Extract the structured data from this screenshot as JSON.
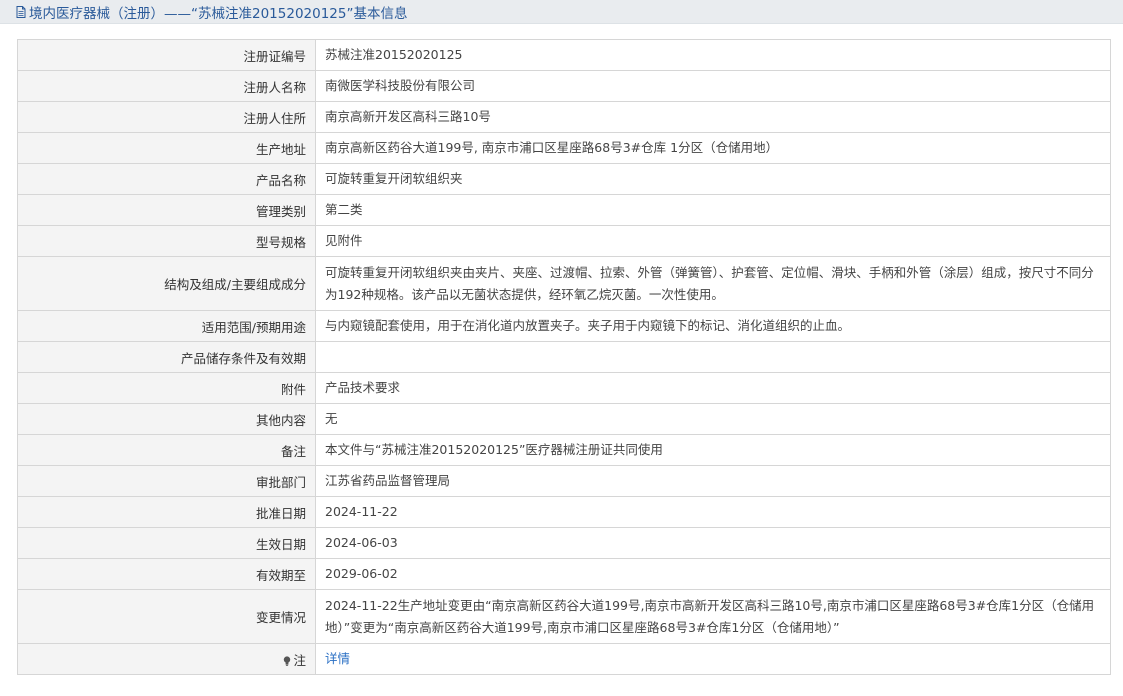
{
  "header": {
    "title": "境内医疗器械（注册）——“苏械注准20152020125”基本信息"
  },
  "rows": [
    {
      "label": "注册证编号",
      "value": "苏械注准20152020125"
    },
    {
      "label": "注册人名称",
      "value": "南微医学科技股份有限公司"
    },
    {
      "label": "注册人住所",
      "value": "南京高新开发区高科三路10号"
    },
    {
      "label": "生产地址",
      "value": "南京高新区药谷大道199号, 南京市浦口区星座路68号3#仓库 1分区（仓储用地）"
    },
    {
      "label": "产品名称",
      "value": "可旋转重复开闭软组织夹"
    },
    {
      "label": "管理类别",
      "value": "第二类"
    },
    {
      "label": "型号规格",
      "value": "见附件"
    },
    {
      "label": "结构及组成/主要组成成分",
      "value": "可旋转重复开闭软组织夹由夹片、夹座、过渡帽、拉索、外管（弹簧管）、护套管、定位帽、滑块、手柄和外管（涂层）组成，按尺寸不同分为192种规格。该产品以无菌状态提供，经环氧乙烷灭菌。一次性使用。"
    },
    {
      "label": "适用范围/预期用途",
      "value": "与内窥镜配套使用，用于在消化道内放置夹子。夹子用于内窥镜下的标记、消化道组织的止血。"
    },
    {
      "label": "产品储存条件及有效期",
      "value": ""
    },
    {
      "label": "附件",
      "value": "产品技术要求"
    },
    {
      "label": "其他内容",
      "value": "无"
    },
    {
      "label": "备注",
      "value": "本文件与“苏械注准20152020125”医疗器械注册证共同使用"
    },
    {
      "label": "审批部门",
      "value": "江苏省药品监督管理局"
    },
    {
      "label": "批准日期",
      "value": "2024-11-22"
    },
    {
      "label": "生效日期",
      "value": "2024-06-03"
    },
    {
      "label": "有效期至",
      "value": "2029-06-02"
    },
    {
      "label": "变更情况",
      "value": "2024-11-22生产地址变更由“南京高新区药谷大道199号,南京市高新开发区高科三路10号,南京市浦口区星座路68号3#仓库1分区（仓储用地）”变更为“南京高新区药谷大道199号,南京市浦口区星座路68号3#仓库1分区（仓储用地）”"
    }
  ],
  "note": {
    "label": "注",
    "link": "详情",
    "icon": "lightbulb-icon"
  },
  "colors": {
    "title": "#2a5a9a",
    "link": "#2a6fc4",
    "label_bg": "#f4f4f4",
    "border": "#d6d6d6"
  }
}
